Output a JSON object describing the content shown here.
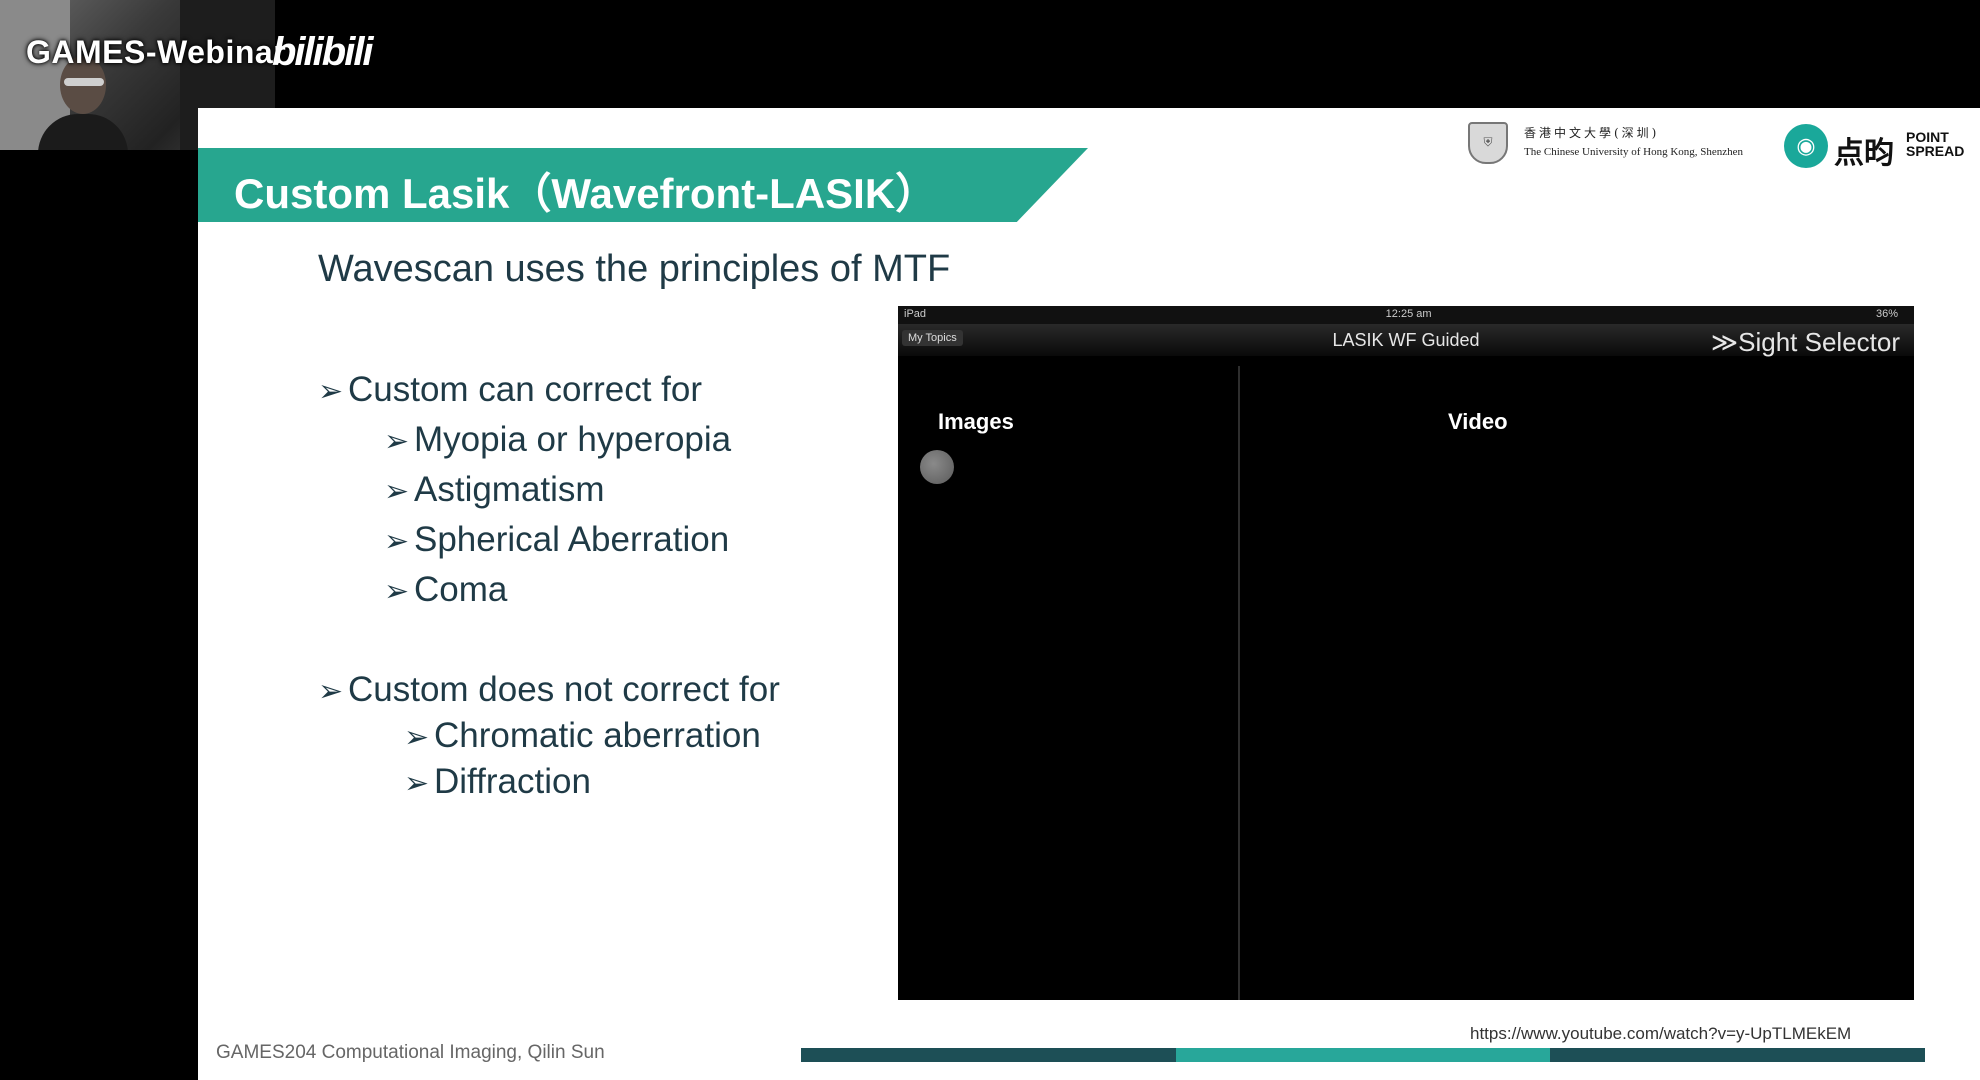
{
  "stream": {
    "brand": "GAMES-Webinar",
    "platform": "bilibili"
  },
  "slide": {
    "title": "Custom Lasik（Wavefront-LASIK）",
    "logos": {
      "cuhk_cn": "香港中文大學(深圳)",
      "cuhk_en": "The Chinese University of Hong Kong, Shenzhen",
      "pointspread_cn": "点昀",
      "pointspread_en_1": "POINT",
      "pointspread_en_2": "SPREAD"
    },
    "subtitle": "Wavescan uses the principles of MTF",
    "bullets": {
      "can_header": "Custom can correct for",
      "can_items": [
        "Myopia or hyperopia",
        "Astigmatism",
        "Spherical Aberration",
        "Coma"
      ],
      "cannot_header": "Custom does not correct for",
      "cannot_items": [
        "Chromatic aberration",
        "Diffraction"
      ]
    },
    "video": {
      "status_left": "iPad",
      "status_time": "12:25 am",
      "status_right": "36%",
      "back_button": "My Topics",
      "nav_title": "LASIK WF Guided",
      "app_brand": "≫Sight Selector",
      "images_label": "Images",
      "video_label": "Video"
    },
    "url": "https://www.youtube.com/watch?v=y-UpTLMEkEM",
    "footer": "GAMES204 Computational Imaging, Qilin Sun"
  },
  "colors": {
    "title_bar": "#27a68f",
    "text_dark": "#1f3a46",
    "bar_segments": [
      "#1d4f56",
      "#28a79a",
      "#1d4f56"
    ]
  }
}
